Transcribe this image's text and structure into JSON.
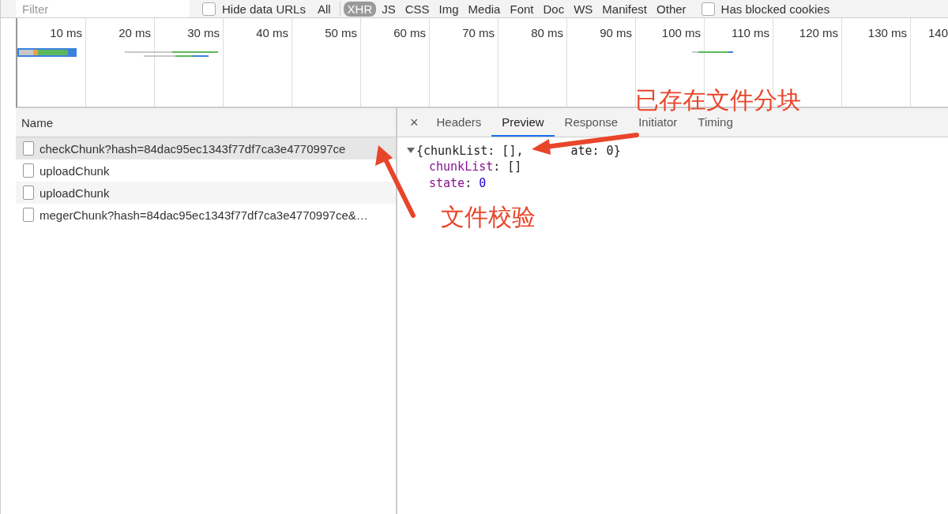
{
  "filter_bar": {
    "placeholder": "Filter",
    "hide_data_urls": {
      "label": "Hide data URLs",
      "checked": false
    },
    "types": [
      {
        "label": "All",
        "selected": false
      },
      {
        "label": "XHR",
        "selected": true
      },
      {
        "label": "JS",
        "selected": false
      },
      {
        "label": "CSS",
        "selected": false
      },
      {
        "label": "Img",
        "selected": false
      },
      {
        "label": "Media",
        "selected": false
      },
      {
        "label": "Font",
        "selected": false
      },
      {
        "label": "Doc",
        "selected": false
      },
      {
        "label": "WS",
        "selected": false
      },
      {
        "label": "Manifest",
        "selected": false
      },
      {
        "label": "Other",
        "selected": false
      }
    ],
    "has_blocked_cookies": {
      "label": "Has blocked cookies",
      "checked": false
    }
  },
  "timeline": {
    "ticks": [
      "10 ms",
      "20 ms",
      "30 ms",
      "40 ms",
      "50 ms",
      "60 ms",
      "70 ms",
      "80 ms",
      "90 ms",
      "100 ms",
      "110 ms",
      "120 ms",
      "130 ms",
      "140"
    ]
  },
  "requests": {
    "header": "Name",
    "rows": [
      {
        "name": "checkChunk?hash=84dac95ec1343f77df7ca3e4770997ce",
        "selected": true
      },
      {
        "name": "uploadChunk",
        "selected": false
      },
      {
        "name": "uploadChunk",
        "selected": false
      },
      {
        "name": "megerChunk?hash=84dac95ec1343f77df7ca3e4770997ce&…",
        "selected": false
      }
    ]
  },
  "detail": {
    "close": "×",
    "tabs": [
      {
        "label": "Headers",
        "selected": false
      },
      {
        "label": "Preview",
        "selected": true
      },
      {
        "label": "Response",
        "selected": false
      },
      {
        "label": "Initiator",
        "selected": false
      },
      {
        "label": "Timing",
        "selected": false
      }
    ],
    "preview": {
      "expanded": true,
      "summary_parts": [
        "{chunkList: [],",
        "ate: 0}"
      ],
      "properties": [
        {
          "key": "chunkList",
          "colon": ":",
          "value": "[]",
          "kind": "array"
        },
        {
          "key": "state",
          "colon": ":",
          "value": "0",
          "kind": "number"
        }
      ]
    }
  },
  "annotations": [
    {
      "text": "已存在文件分块"
    },
    {
      "text": "文件校验"
    }
  ]
}
